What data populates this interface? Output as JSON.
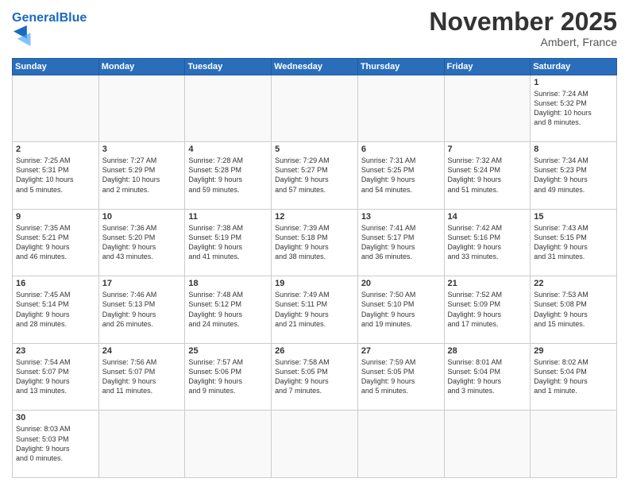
{
  "header": {
    "logo_general": "General",
    "logo_blue": "Blue",
    "month": "November 2025",
    "location": "Ambert, France"
  },
  "days_header": [
    "Sunday",
    "Monday",
    "Tuesday",
    "Wednesday",
    "Thursday",
    "Friday",
    "Saturday"
  ],
  "weeks": [
    [
      {
        "day": "",
        "info": ""
      },
      {
        "day": "",
        "info": ""
      },
      {
        "day": "",
        "info": ""
      },
      {
        "day": "",
        "info": ""
      },
      {
        "day": "",
        "info": ""
      },
      {
        "day": "",
        "info": ""
      },
      {
        "day": "1",
        "info": "Sunrise: 7:24 AM\nSunset: 5:32 PM\nDaylight: 10 hours\nand 8 minutes."
      }
    ],
    [
      {
        "day": "2",
        "info": "Sunrise: 7:25 AM\nSunset: 5:31 PM\nDaylight: 10 hours\nand 5 minutes."
      },
      {
        "day": "3",
        "info": "Sunrise: 7:27 AM\nSunset: 5:29 PM\nDaylight: 10 hours\nand 2 minutes."
      },
      {
        "day": "4",
        "info": "Sunrise: 7:28 AM\nSunset: 5:28 PM\nDaylight: 9 hours\nand 59 minutes."
      },
      {
        "day": "5",
        "info": "Sunrise: 7:29 AM\nSunset: 5:27 PM\nDaylight: 9 hours\nand 57 minutes."
      },
      {
        "day": "6",
        "info": "Sunrise: 7:31 AM\nSunset: 5:25 PM\nDaylight: 9 hours\nand 54 minutes."
      },
      {
        "day": "7",
        "info": "Sunrise: 7:32 AM\nSunset: 5:24 PM\nDaylight: 9 hours\nand 51 minutes."
      },
      {
        "day": "8",
        "info": "Sunrise: 7:34 AM\nSunset: 5:23 PM\nDaylight: 9 hours\nand 49 minutes."
      }
    ],
    [
      {
        "day": "9",
        "info": "Sunrise: 7:35 AM\nSunset: 5:21 PM\nDaylight: 9 hours\nand 46 minutes."
      },
      {
        "day": "10",
        "info": "Sunrise: 7:36 AM\nSunset: 5:20 PM\nDaylight: 9 hours\nand 43 minutes."
      },
      {
        "day": "11",
        "info": "Sunrise: 7:38 AM\nSunset: 5:19 PM\nDaylight: 9 hours\nand 41 minutes."
      },
      {
        "day": "12",
        "info": "Sunrise: 7:39 AM\nSunset: 5:18 PM\nDaylight: 9 hours\nand 38 minutes."
      },
      {
        "day": "13",
        "info": "Sunrise: 7:41 AM\nSunset: 5:17 PM\nDaylight: 9 hours\nand 36 minutes."
      },
      {
        "day": "14",
        "info": "Sunrise: 7:42 AM\nSunset: 5:16 PM\nDaylight: 9 hours\nand 33 minutes."
      },
      {
        "day": "15",
        "info": "Sunrise: 7:43 AM\nSunset: 5:15 PM\nDaylight: 9 hours\nand 31 minutes."
      }
    ],
    [
      {
        "day": "16",
        "info": "Sunrise: 7:45 AM\nSunset: 5:14 PM\nDaylight: 9 hours\nand 28 minutes."
      },
      {
        "day": "17",
        "info": "Sunrise: 7:46 AM\nSunset: 5:13 PM\nDaylight: 9 hours\nand 26 minutes."
      },
      {
        "day": "18",
        "info": "Sunrise: 7:48 AM\nSunset: 5:12 PM\nDaylight: 9 hours\nand 24 minutes."
      },
      {
        "day": "19",
        "info": "Sunrise: 7:49 AM\nSunset: 5:11 PM\nDaylight: 9 hours\nand 21 minutes."
      },
      {
        "day": "20",
        "info": "Sunrise: 7:50 AM\nSunset: 5:10 PM\nDaylight: 9 hours\nand 19 minutes."
      },
      {
        "day": "21",
        "info": "Sunrise: 7:52 AM\nSunset: 5:09 PM\nDaylight: 9 hours\nand 17 minutes."
      },
      {
        "day": "22",
        "info": "Sunrise: 7:53 AM\nSunset: 5:08 PM\nDaylight: 9 hours\nand 15 minutes."
      }
    ],
    [
      {
        "day": "23",
        "info": "Sunrise: 7:54 AM\nSunset: 5:07 PM\nDaylight: 9 hours\nand 13 minutes."
      },
      {
        "day": "24",
        "info": "Sunrise: 7:56 AM\nSunset: 5:07 PM\nDaylight: 9 hours\nand 11 minutes."
      },
      {
        "day": "25",
        "info": "Sunrise: 7:57 AM\nSunset: 5:06 PM\nDaylight: 9 hours\nand 9 minutes."
      },
      {
        "day": "26",
        "info": "Sunrise: 7:58 AM\nSunset: 5:05 PM\nDaylight: 9 hours\nand 7 minutes."
      },
      {
        "day": "27",
        "info": "Sunrise: 7:59 AM\nSunset: 5:05 PM\nDaylight: 9 hours\nand 5 minutes."
      },
      {
        "day": "28",
        "info": "Sunrise: 8:01 AM\nSunset: 5:04 PM\nDaylight: 9 hours\nand 3 minutes."
      },
      {
        "day": "29",
        "info": "Sunrise: 8:02 AM\nSunset: 5:04 PM\nDaylight: 9 hours\nand 1 minute."
      }
    ],
    [
      {
        "day": "30",
        "info": "Sunrise: 8:03 AM\nSunset: 5:03 PM\nDaylight: 9 hours\nand 0 minutes."
      },
      {
        "day": "",
        "info": ""
      },
      {
        "day": "",
        "info": ""
      },
      {
        "day": "",
        "info": ""
      },
      {
        "day": "",
        "info": ""
      },
      {
        "day": "",
        "info": ""
      },
      {
        "day": "",
        "info": ""
      }
    ]
  ]
}
